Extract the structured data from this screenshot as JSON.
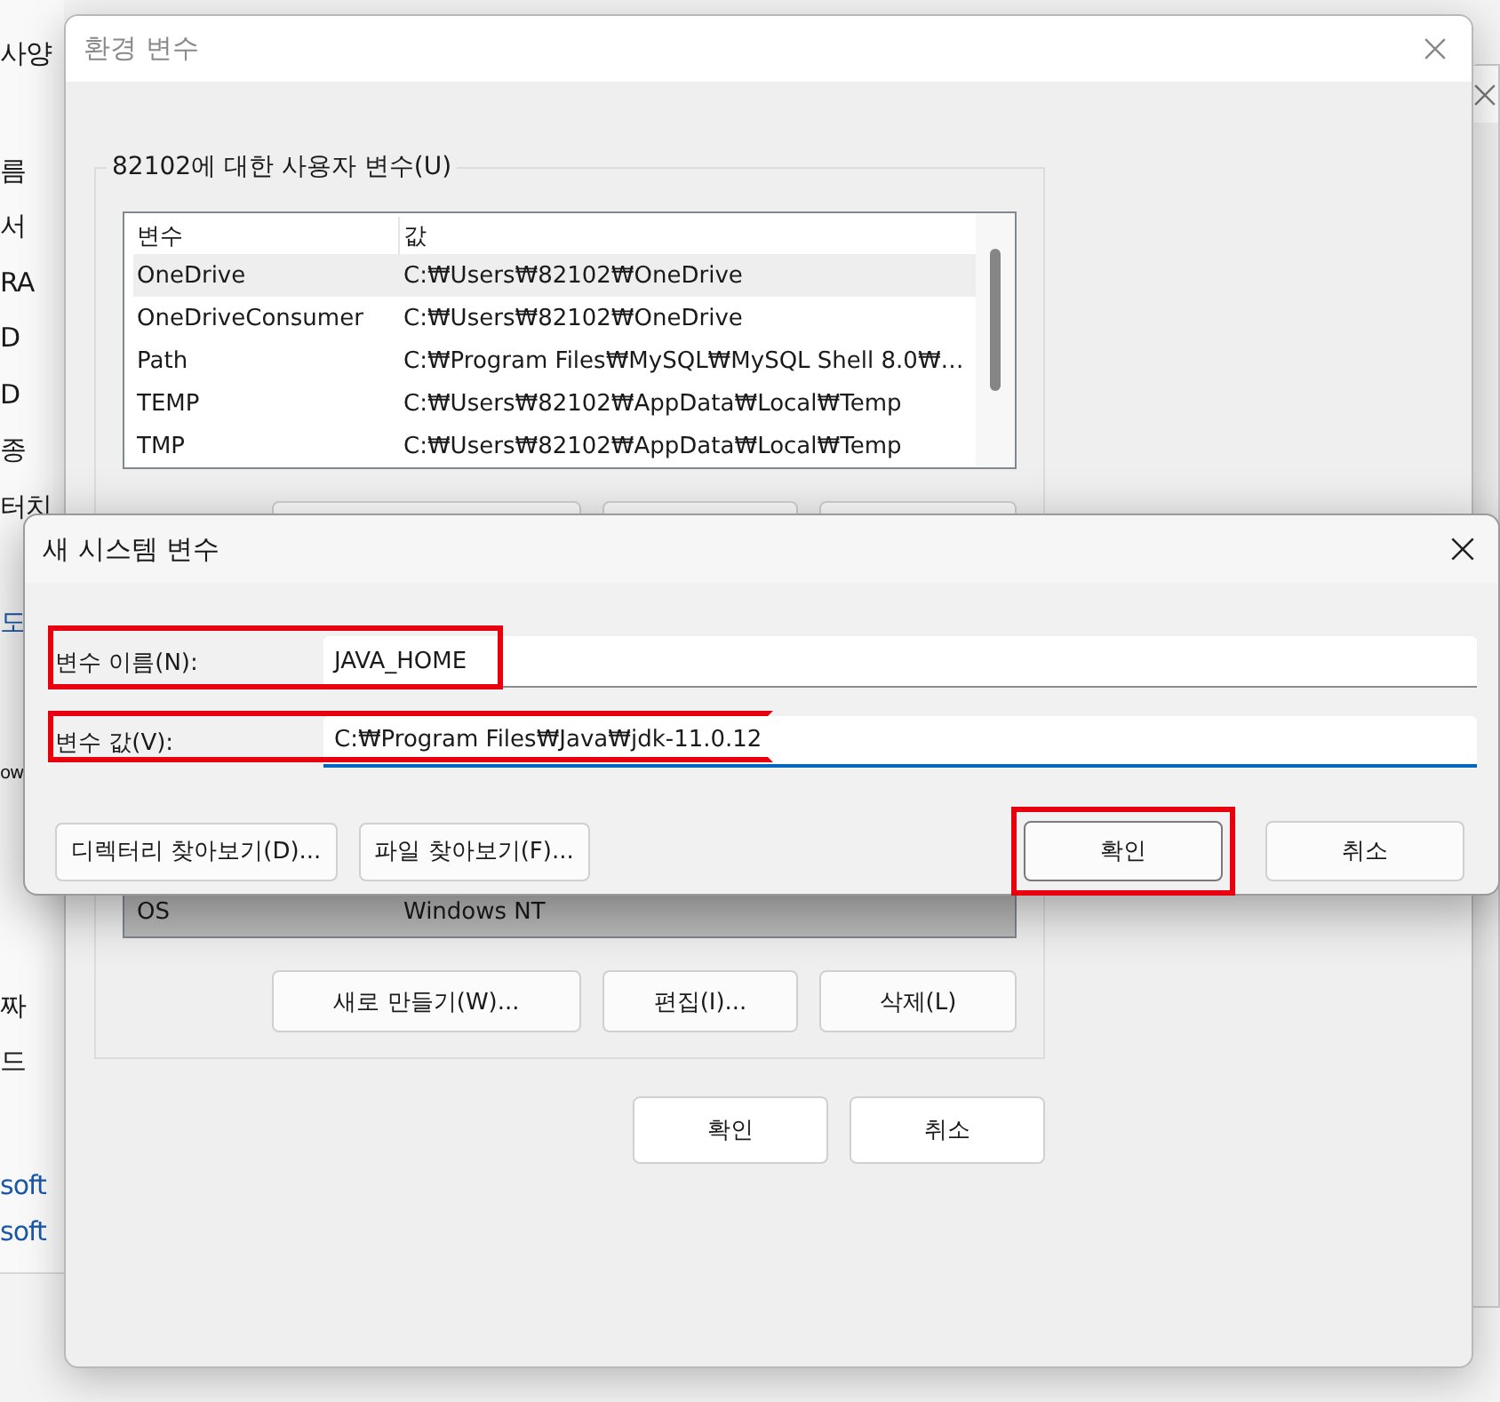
{
  "background_window": {
    "sections": [
      {
        "items": [
          {
            "text": "사양",
            "kind": "label"
          }
        ]
      },
      {
        "items": [
          {
            "text": "름",
            "kind": "label"
          },
          {
            "text": "서",
            "kind": "label"
          },
          {
            "text": "RA",
            "kind": "label"
          },
          {
            "text": "D",
            "kind": "label"
          },
          {
            "text": "D",
            "kind": "label"
          },
          {
            "text": "종",
            "kind": "label"
          },
          {
            "text": "터치",
            "kind": "label"
          }
        ]
      },
      {
        "items": [
          {
            "text": "도",
            "kind": "link"
          }
        ]
      },
      {
        "items": [
          {
            "text": "ow",
            "kind": "label"
          }
        ]
      },
      {
        "items": [
          {
            "text": "짜",
            "kind": "label"
          },
          {
            "text": "드",
            "kind": "label"
          }
        ]
      },
      {
        "items": [
          {
            "text": "soft",
            "kind": "link"
          },
          {
            "text": "soft",
            "kind": "link"
          }
        ]
      }
    ]
  },
  "main_window": {
    "title": "환경 변수",
    "user_group": {
      "title": "82102에 대한 사용자 변수(U)",
      "columns": [
        "변수",
        "값"
      ],
      "rows": [
        {
          "cells": [
            "OneDrive",
            "C:₩Users₩82102₩OneDrive"
          ],
          "selected": true
        },
        {
          "cells": [
            "OneDriveConsumer",
            "C:₩Users₩82102₩OneDrive"
          ],
          "selected": false
        },
        {
          "cells": [
            "Path",
            "C:₩Program Files₩MySQL₩MySQL Shell 8.0₩…"
          ],
          "selected": false
        },
        {
          "cells": [
            "TEMP",
            "C:₩Users₩82102₩AppData₩Local₩Temp"
          ],
          "selected": false
        },
        {
          "cells": [
            "TMP",
            "C:₩Users₩82102₩AppData₩Local₩Temp"
          ],
          "selected": false
        }
      ],
      "buttons": [
        {
          "kind": "covered"
        },
        {
          "kind": "covered"
        },
        {
          "kind": "covered"
        }
      ]
    },
    "system_group": {
      "rows": [
        {
          "cells": [
            "OS",
            "Windows NT"
          ],
          "selected": false
        }
      ],
      "buttons": [
        "새로 만들기(W)...",
        "편집(I)...",
        "삭제(L)"
      ]
    },
    "buttons": [
      "확인",
      "취소"
    ]
  },
  "dialog": {
    "title": "새 시스템 변수",
    "fields": [
      {
        "label": "변수 이름(N):",
        "value": "JAVA_HOME",
        "focused": false,
        "highlighted": true
      },
      {
        "label": "변수 값(V):",
        "value": "C:₩Program Files₩Java₩jdk-11.0.12",
        "focused": true,
        "highlighted": true
      }
    ],
    "browse_buttons": [
      "디렉터리 찾아보기(D)...",
      "파일 찾아보기(F)..."
    ],
    "buttons": [
      {
        "label": "확인",
        "default": true,
        "highlighted": true
      },
      {
        "label": "취소",
        "default": false,
        "highlighted": false
      }
    ]
  }
}
